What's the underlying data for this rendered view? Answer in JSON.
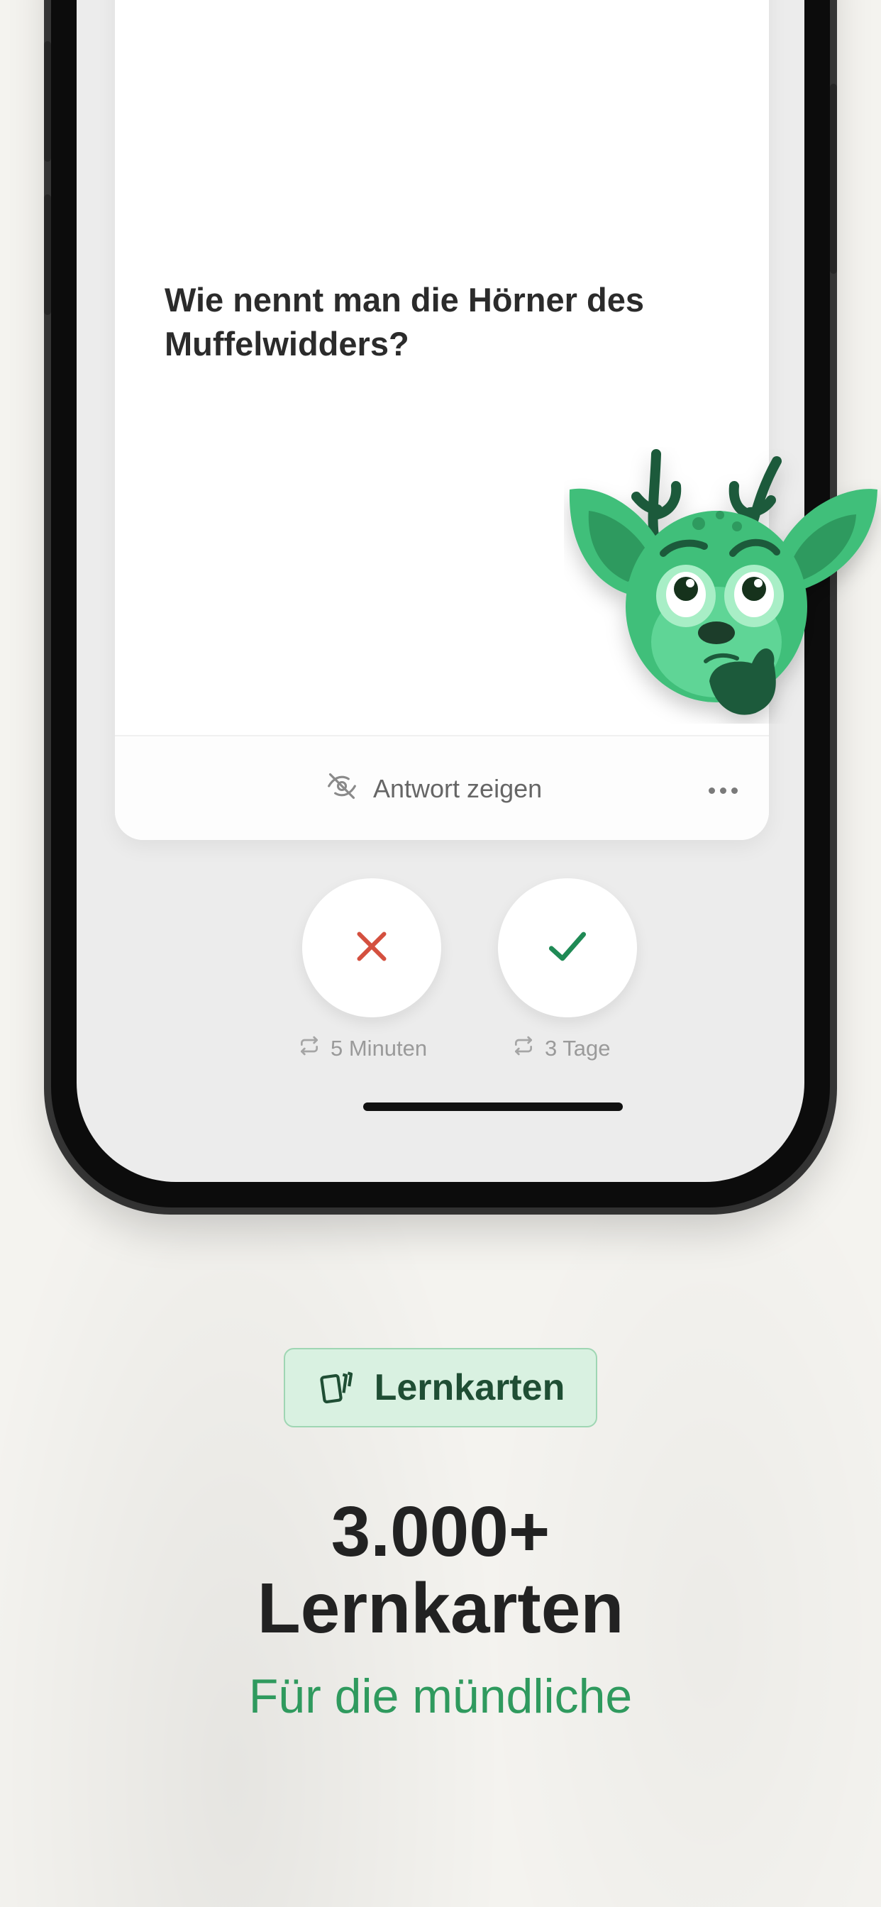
{
  "card": {
    "question": "Wie nennt man die Hörner des Muffelwidders?",
    "reveal_label": "Antwort zeigen"
  },
  "answers": {
    "wrong_interval": "5 Minuten",
    "right_interval": "3 Tage"
  },
  "badge": {
    "label": "Lernkarten"
  },
  "headline": {
    "line1": "3.000+",
    "line2": "Lernkarten"
  },
  "subline": "Für die mündliche",
  "colors": {
    "accent_green": "#2f9a5e",
    "wrong_red": "#d4503f",
    "badge_bg": "#d9f1e1"
  },
  "icons": [
    "eye-off-icon",
    "more-icon",
    "close-icon",
    "check-icon",
    "repeat-icon",
    "cards-icon",
    "deer-mascot"
  ]
}
